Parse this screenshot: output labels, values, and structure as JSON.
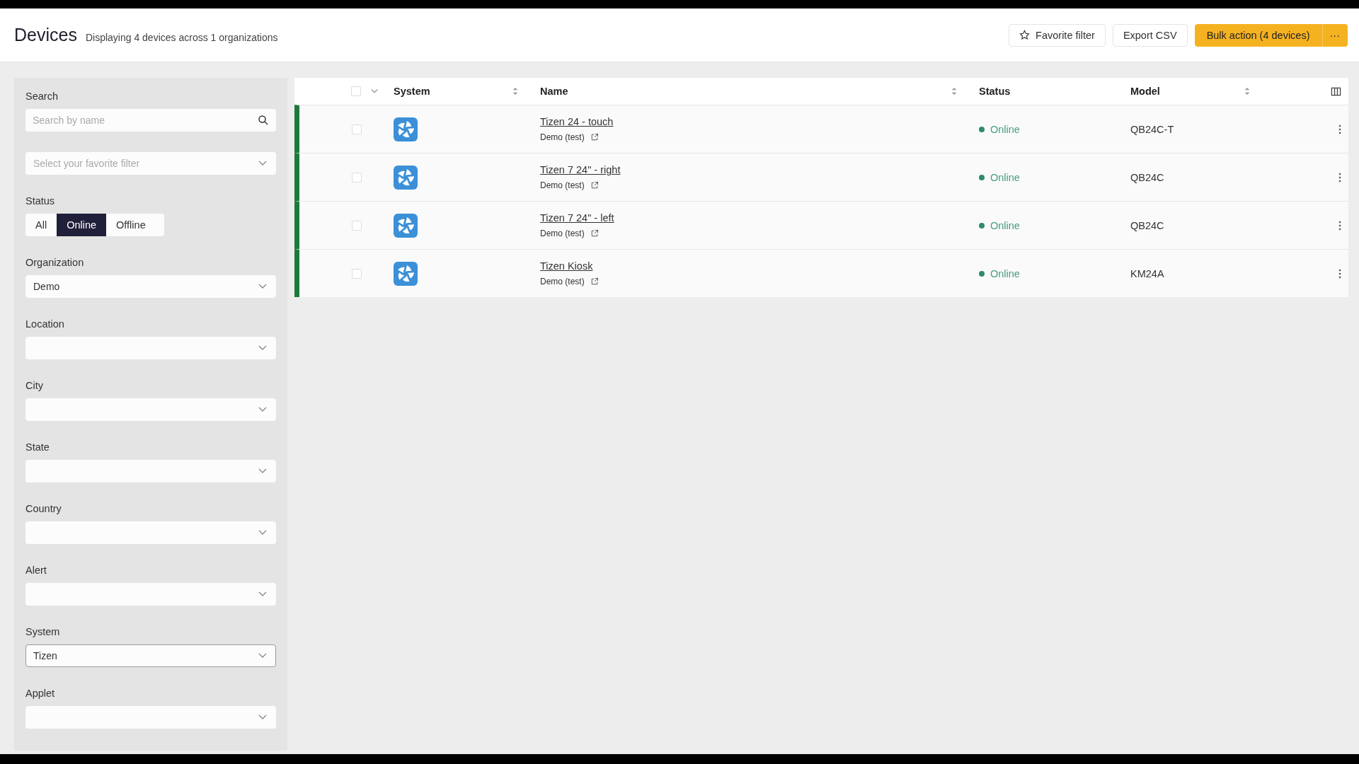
{
  "header": {
    "title": "Devices",
    "subtitle": "Displaying 4 devices across 1 organizations",
    "buttons": [
      {
        "kind": "favorite",
        "label": "Favorite filter"
      },
      {
        "kind": "plain",
        "label": "Export CSV"
      },
      {
        "kind": "primary",
        "label": "Bulk action (4 devices)",
        "menu": "···"
      }
    ]
  },
  "filters": [
    {
      "kind": "search",
      "label": "Search",
      "placeholder": "Search by name"
    },
    {
      "kind": "select",
      "placeholder": "Select your favorite filter"
    },
    {
      "kind": "segmented",
      "label": "Status",
      "options": [
        {
          "label": "All",
          "selected": false
        },
        {
          "label": "Online",
          "selected": true
        },
        {
          "label": "Offline",
          "selected": false
        }
      ]
    },
    {
      "kind": "select",
      "label": "Organization",
      "value": "Demo"
    },
    {
      "kind": "select",
      "label": "Location"
    },
    {
      "kind": "select",
      "label": "City"
    },
    {
      "kind": "select",
      "label": "State"
    },
    {
      "kind": "select",
      "label": "Country"
    },
    {
      "kind": "select",
      "label": "Alert"
    },
    {
      "kind": "select",
      "label": "System",
      "value": "Tizen",
      "focused": true
    },
    {
      "kind": "select",
      "label": "Applet"
    }
  ],
  "table": {
    "select_all": {
      "checked": false
    },
    "columns": [
      {
        "label": "System",
        "sortable": true
      },
      {
        "label": "Name",
        "sortable": true
      },
      {
        "label": "Status",
        "sortable": false
      },
      {
        "label": "Model",
        "sortable": true
      }
    ],
    "rows": [
      {
        "checked": false,
        "name": "Tizen 24 - touch",
        "organization": "Demo (test)",
        "status": "Online",
        "color": "#2e8b6e",
        "model": "QB24C-T"
      },
      {
        "checked": false,
        "name": "Tizen 7 24\" - right",
        "organization": "Demo (test)",
        "status": "Online",
        "color": "#2e8b6e",
        "model": "QB24C"
      },
      {
        "checked": false,
        "name": "Tizen 7 24\" - left",
        "organization": "Demo (test)",
        "status": "Online",
        "color": "#2e8b6e",
        "model": "QB24C"
      },
      {
        "checked": false,
        "name": "Tizen Kiosk",
        "organization": "Demo (test)",
        "status": "Online",
        "color": "#2e8b6e",
        "model": "KM24A"
      }
    ]
  }
}
